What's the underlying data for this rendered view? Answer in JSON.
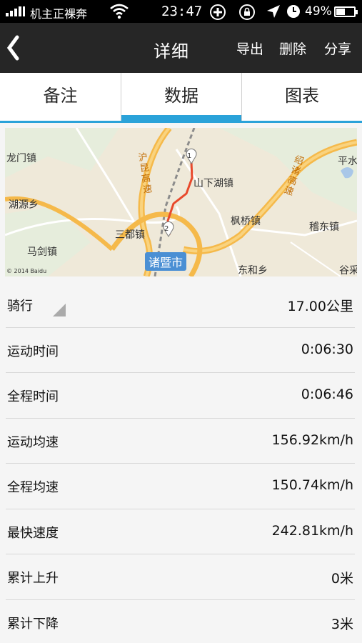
{
  "status": {
    "carrier": "机主正裸奔",
    "time": "23:47",
    "battery_pct": "49%"
  },
  "header": {
    "title": "详细",
    "back_icon": "chevron-left-icon",
    "actions": {
      "export": "导出",
      "delete": "删除",
      "share": "分享"
    }
  },
  "tabs": [
    {
      "label": "备注",
      "active": false
    },
    {
      "label": "数据",
      "active": true
    },
    {
      "label": "图表",
      "active": false
    }
  ],
  "map": {
    "labels": {
      "longmen": "龙门镇",
      "huyuan": "湖源乡",
      "majian": "马剑镇",
      "sandu": "三都镇",
      "shanxiahu": "山下湖镇",
      "fengqiao": "枫桥镇",
      "jidong": "稽东镇",
      "donghe": "东和乡",
      "pingshui": "平水",
      "guxi": "谷采",
      "hukun": "沪昆高速",
      "shaozhu": "绍诸高速",
      "city": "诸暨市"
    },
    "copyright": "© 2014 Baidu",
    "markers": [
      "1",
      "2"
    ],
    "route_color": "#e8492c"
  },
  "stats": {
    "mode": {
      "label": "骑行",
      "value": "17.00公里"
    },
    "moving_time": {
      "label": "运动时间",
      "value": "0:06:30"
    },
    "total_time": {
      "label": "全程时间",
      "value": "0:06:46"
    },
    "moving_avg": {
      "label": "运动均速",
      "value": "156.92km/h"
    },
    "total_avg": {
      "label": "全程均速",
      "value": "150.74km/h"
    },
    "max_speed": {
      "label": "最快速度",
      "value": "242.81km/h"
    },
    "ascent": {
      "label": "累计上升",
      "value": "0米"
    },
    "descent": {
      "label": "累计下降",
      "value": "3米"
    }
  },
  "colors": {
    "accent": "#2aa2d9",
    "header_bg": "#262626"
  }
}
